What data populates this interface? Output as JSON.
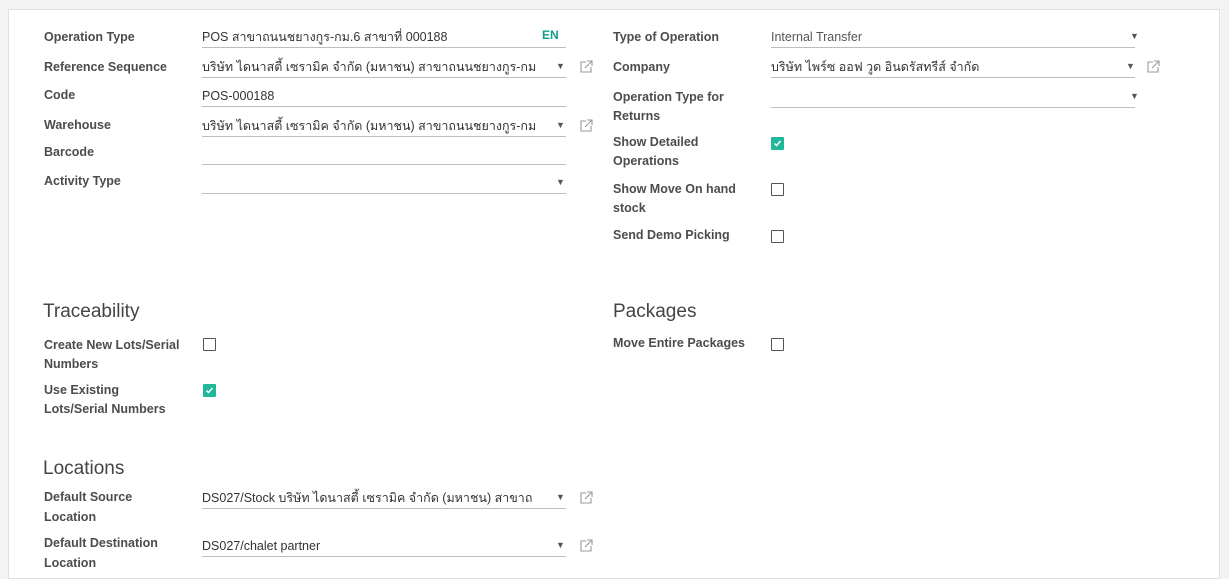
{
  "left_fields": {
    "operation_type": {
      "label": "Operation Type",
      "value": "POS  สาขาถนนชยางกูร-กม.6 สาขาที่ 000188",
      "lang": "EN"
    },
    "reference_sequence": {
      "label": "Reference Sequence",
      "value": "บริษัท ไดนาสตี้ เซรามิค จำกัด (มหาชน) สาขาถนนชยางกูร-กม"
    },
    "code": {
      "label": "Code",
      "value": "POS-000188"
    },
    "warehouse": {
      "label": "Warehouse",
      "value": "บริษัท ไดนาสตี้ เซรามิค จำกัด (มหาชน) สาขาถนนชยางกูร-กม"
    },
    "barcode": {
      "label": "Barcode",
      "value": ""
    },
    "activity_type": {
      "label": "Activity Type",
      "value": ""
    }
  },
  "right_fields": {
    "type_of_operation": {
      "label": "Type of Operation",
      "value": "Internal Transfer"
    },
    "company": {
      "label": "Company",
      "value": "บริษัท ไพร์ซ ออฟ วูด อินดรัสทรีส์ จำกัด"
    },
    "return_type": {
      "label_line1": "Operation Type for",
      "label_line2": "Returns",
      "value": ""
    },
    "show_detailed": {
      "label_line1": "Show Detailed",
      "label_line2": "Operations",
      "checked": true
    },
    "show_move_onhand": {
      "label_line1": "Show Move On hand",
      "label_line2": "stock",
      "checked": false
    },
    "send_demo": {
      "label": "Send Demo Picking",
      "checked": false
    }
  },
  "traceability": {
    "title": "Traceability",
    "create_lots": {
      "label_line1": "Create New Lots/Serial",
      "label_line2": "Numbers",
      "checked": false
    },
    "use_existing": {
      "label_line1": "Use Existing",
      "label_line2": "Lots/Serial Numbers",
      "checked": true
    }
  },
  "packages": {
    "title": "Packages",
    "move_entire": {
      "label": "Move Entire Packages",
      "checked": false
    }
  },
  "locations": {
    "title": "Locations",
    "default_source": {
      "label_line1": "Default Source",
      "label_line2": "Location",
      "value": "DS027/Stock บริษัท ไดนาสตี้ เซรามิค จำกัด (มหาชน) สาขาถ"
    },
    "default_destination": {
      "label_line1": "Default Destination",
      "label_line2": "Location",
      "value": "DS027/chalet partner"
    }
  },
  "colors": {
    "accent": "#21b799",
    "lang_badge": "#0f9d8a"
  }
}
